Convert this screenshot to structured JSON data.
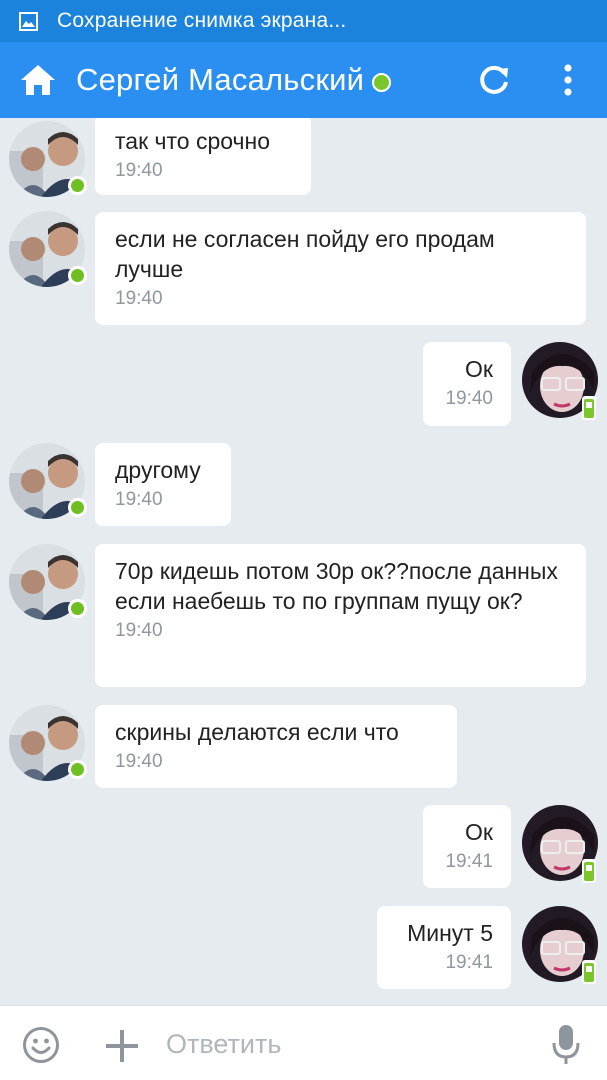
{
  "status_bar": {
    "notification_text": "Сохранение снимка экрана..."
  },
  "header": {
    "contact_name": "Сергей Масальский"
  },
  "messages": [
    {
      "direction": "in",
      "text": "так что срочно",
      "time": "19:40"
    },
    {
      "direction": "in",
      "text": "если не согласен пойду его продам лучше",
      "time": "19:40"
    },
    {
      "direction": "out",
      "text": "Ок",
      "time": "19:40"
    },
    {
      "direction": "in",
      "text": "другому",
      "time": "19:40"
    },
    {
      "direction": "in",
      "text": "70р кидешь потом 30р ок??после данных если наебешь то по группам пущу ок?",
      "time": "19:40"
    },
    {
      "direction": "in",
      "text": "скрины делаются если что",
      "time": "19:40"
    },
    {
      "direction": "out",
      "text": "Ок",
      "time": "19:41"
    },
    {
      "direction": "out",
      "text": "Минут 5",
      "time": "19:41"
    }
  ],
  "input": {
    "placeholder": "Ответить"
  },
  "colors": {
    "header_bg": "#2a8ff0",
    "status_bar_bg": "#1c83dc",
    "chat_bg": "#e6ebf0",
    "online_green": "#7ac62c"
  },
  "icons": [
    "screenshot-icon",
    "home-icon",
    "online-dot",
    "refresh-icon",
    "more-vert-icon",
    "emoji-icon",
    "plus-icon",
    "mic-icon",
    "mobile-status-icon"
  ]
}
